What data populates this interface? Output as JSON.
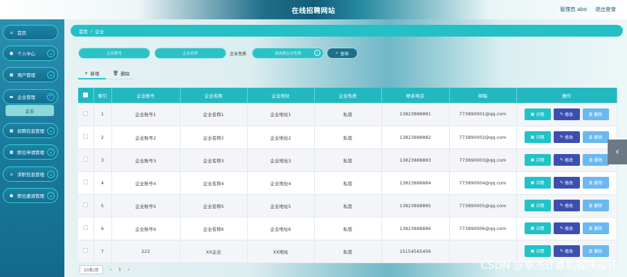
{
  "header": {
    "title": "在线招聘网站",
    "admin_label": "管理员 abo",
    "logout_label": "退出登录"
  },
  "sidebar": {
    "items": [
      {
        "label": "首页",
        "icon": "home-icon"
      },
      {
        "label": "个人中心",
        "icon": "user-icon"
      },
      {
        "label": "用户管理",
        "icon": "grid-icon"
      },
      {
        "label": "企业管理",
        "icon": "monitor-icon"
      },
      {
        "label": "招聘信息管理",
        "icon": "grid-icon"
      },
      {
        "label": "职位申请管理",
        "icon": "grid-icon"
      },
      {
        "label": "求职信息管理",
        "icon": "home-icon"
      },
      {
        "label": "职位邀请管理",
        "icon": "pin-icon"
      }
    ],
    "submenu_label": "企业"
  },
  "breadcrumb": {
    "home": "首页",
    "separator": "/",
    "current": "企业"
  },
  "search": {
    "account_placeholder": "企业账号",
    "name_placeholder": "企业名称",
    "nature_label": "企业性质",
    "nature_placeholder": "请选择企业性质",
    "query_label": "查询"
  },
  "actions": {
    "add_label": "新增",
    "delete_label": "删除"
  },
  "table": {
    "headers": [
      "索引",
      "企业账号",
      "企业名称",
      "企业地址",
      "企业性质",
      "联系电话",
      "邮箱",
      "操作"
    ],
    "rows": [
      {
        "index": "1",
        "account": "企业账号1",
        "name": "企业名称1",
        "address": "企业地址1",
        "nature": "私营",
        "phone": "13823888881",
        "email": "773890001@qq.com"
      },
      {
        "index": "2",
        "account": "企业账号2",
        "name": "企业名称2",
        "address": "企业地址2",
        "nature": "私营",
        "phone": "13823888882",
        "email": "773890002@qq.com"
      },
      {
        "index": "3",
        "account": "企业账号3",
        "name": "企业名称3",
        "address": "企业地址3",
        "nature": "私营",
        "phone": "13823888883",
        "email": "773890003@qq.com"
      },
      {
        "index": "4",
        "account": "企业账号4",
        "name": "企业名称4",
        "address": "企业地址4",
        "nature": "私营",
        "phone": "13823888884",
        "email": "773890004@qq.com"
      },
      {
        "index": "5",
        "account": "企业账号5",
        "name": "企业名称5",
        "address": "企业地址5",
        "nature": "私营",
        "phone": "13823888885",
        "email": "773890005@qq.com"
      },
      {
        "index": "6",
        "account": "企业账号6",
        "name": "企业名称6",
        "address": "企业地址6",
        "nature": "私营",
        "phone": "13823888886",
        "email": "773890006@qq.com"
      },
      {
        "index": "7",
        "account": "222",
        "name": "XX企业",
        "address": "XX地址",
        "nature": "私营",
        "phone": "15154565456",
        "email": ""
      }
    ],
    "ops": {
      "detail": "详情",
      "edit": "修改",
      "delete": "删除"
    }
  },
  "pager": {
    "page_size": "10条/页",
    "prev": "‹",
    "page": "1",
    "next": "›"
  },
  "watermark": "CSDN @卓杰计算机程序设计",
  "colors": {
    "accent": "#23b8c0",
    "edit_button": "#3c4fb0",
    "delete_button": "#6ab8ef",
    "sidebar": "#1c7ea0"
  }
}
